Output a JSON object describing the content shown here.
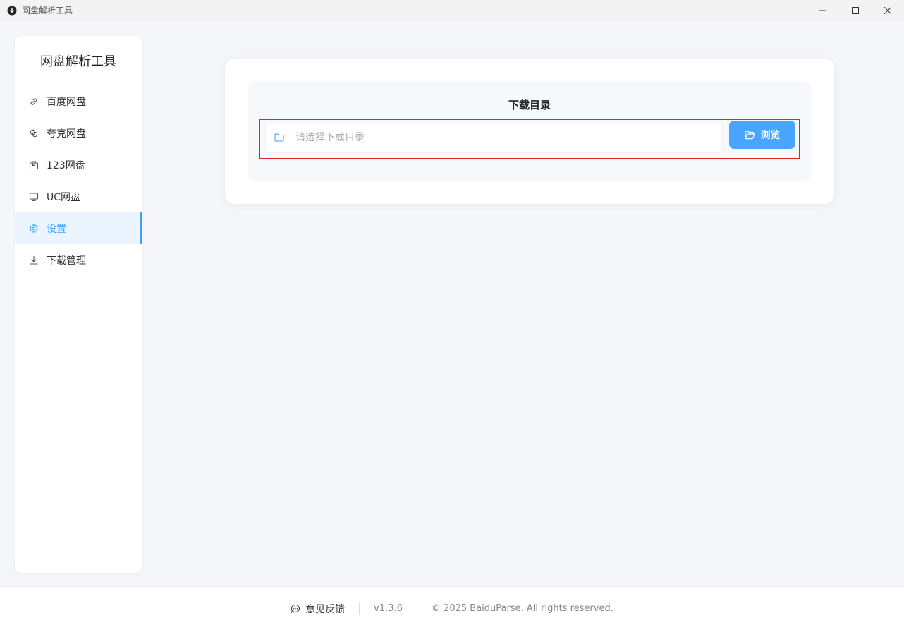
{
  "window": {
    "title": "网盘解析工具"
  },
  "sidebar": {
    "title": "网盘解析工具",
    "items": [
      {
        "label": "百度网盘",
        "icon": "link-icon"
      },
      {
        "label": "夸克网盘",
        "icon": "link-circles-icon"
      },
      {
        "label": "123网盘",
        "icon": "box-icon"
      },
      {
        "label": "UC网盘",
        "icon": "monitor-icon"
      },
      {
        "label": "设置",
        "icon": "gear-icon",
        "active": true
      },
      {
        "label": "下载管理",
        "icon": "download-icon"
      }
    ]
  },
  "settings": {
    "section_title": "下载目录",
    "dir_input": {
      "value": "",
      "placeholder": "请选择下载目录"
    },
    "browse_label": "浏览"
  },
  "footer": {
    "feedback": "意见反馈",
    "version": "v1.3.6",
    "copyright": "© 2025 BaiduParse. All rights reserved."
  },
  "colors": {
    "accent": "#409eff",
    "button": "#4aa5ff",
    "highlight": "#d9252e"
  }
}
